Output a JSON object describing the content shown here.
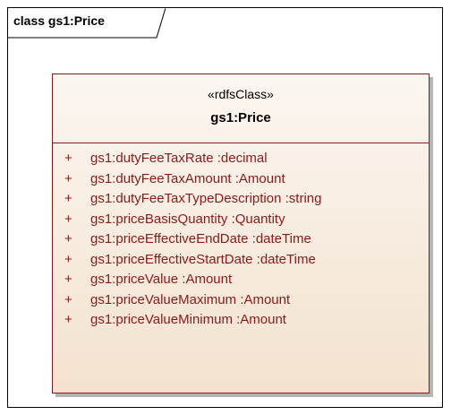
{
  "frame": {
    "title": "class gs1:Price"
  },
  "class": {
    "stereotype": "«rdfsClass»",
    "name": "gs1:Price",
    "attributes": [
      {
        "visibility": "+",
        "text": "gs1:dutyFeeTaxRate  :decimal"
      },
      {
        "visibility": "+",
        "text": "gs1:dutyFeeTaxAmount  :Amount"
      },
      {
        "visibility": "+",
        "text": "gs1:dutyFeeTaxTypeDescription  :string"
      },
      {
        "visibility": "+",
        "text": "gs1:priceBasisQuantity  :Quantity"
      },
      {
        "visibility": "+",
        "text": "gs1:priceEffectiveEndDate  :dateTime"
      },
      {
        "visibility": "+",
        "text": "gs1:priceEffectiveStartDate  :dateTime"
      },
      {
        "visibility": "+",
        "text": "gs1:priceValue  :Amount"
      },
      {
        "visibility": "+",
        "text": "gs1:priceValueMaximum  :Amount"
      },
      {
        "visibility": "+",
        "text": "gs1:priceValueMinimum  :Amount"
      }
    ]
  },
  "colors": {
    "attribute_text": "#8b1a1a",
    "class_border": "#7b1f1f",
    "class_fill_top": "#fbf6f0",
    "class_fill_bottom": "#f3e2cf"
  }
}
